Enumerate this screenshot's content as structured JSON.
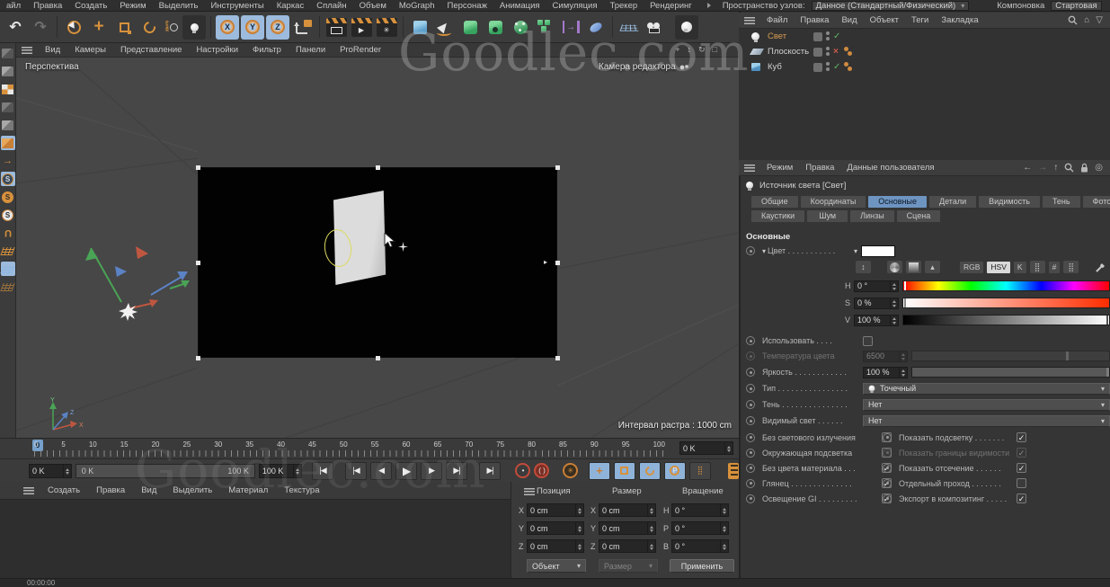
{
  "menubar": {
    "items": [
      "айл",
      "Правка",
      "Создать",
      "Режим",
      "Выделить",
      "Инструменты",
      "Каркас",
      "Сплайн",
      "Объем",
      "MoGraph",
      "Персонаж",
      "Анимация",
      "Симуляция",
      "Трекер",
      "Рендеринг"
    ],
    "node_space_label": "Пространство узлов:",
    "node_space_value": "Данное (Стандартный/Физический)",
    "layout_label": "Компоновка",
    "layout_value": "Стартовая"
  },
  "viewport": {
    "menu": [
      "Вид",
      "Камеры",
      "Представление",
      "Настройки",
      "Фильтр",
      "Панели",
      "ProRender"
    ],
    "view_label": "Перспектива",
    "camera_label": "Камера редактора",
    "raster_interval": "Интервал растра : 1000 cm",
    "axis": {
      "x": "X",
      "y": "Y",
      "z": "Z"
    }
  },
  "object_manager": {
    "menu": [
      "Файл",
      "Правка",
      "Вид",
      "Объект",
      "Теги",
      "Закладка"
    ],
    "objects": [
      {
        "name": "Свет",
        "state": "✓"
      },
      {
        "name": "Плоскость",
        "state": "×"
      },
      {
        "name": "Куб",
        "state": "✓"
      }
    ]
  },
  "attributes": {
    "menu": [
      "Режим",
      "Правка",
      "Данные пользователя"
    ],
    "title": "Источник света [Свет]",
    "tabs_row1": [
      "Общие",
      "Координаты",
      "Основные",
      "Детали",
      "Видимость",
      "Тень",
      "Фотометрия"
    ],
    "tabs_row2": [
      "Каустики",
      "Шум",
      "Линзы",
      "Сцена"
    ],
    "active_tab": "Основные",
    "section_title": "Основные",
    "color": {
      "label": "Цвет . . . . . . . . . . .",
      "rgb": "RGB",
      "hsv": "HSV",
      "k": "K",
      "hash": "#",
      "h_label": "H",
      "h_value": "0 °",
      "s_label": "S",
      "s_value": "0 %",
      "v_label": "V",
      "v_value": "100 %"
    },
    "rows": {
      "use_label": "Использовать . . . .",
      "temp_label": "Температура цвета",
      "temp_value": "6500",
      "brightness_label": "Яркость . . . . . . . . . . . .",
      "brightness_value": "100 %",
      "type_label": "Тип . . . . . . . . . . . . . . . .",
      "type_value": "Точечный",
      "shadow_label": "Тень . . . . . . . . . . . . . . .",
      "shadow_value": "Нет",
      "visible_label": "Видимый свет . . . . . .",
      "visible_value": "Нет"
    },
    "checkboxes_left": [
      {
        "label": "Без светового излучения",
        "mark": ""
      },
      {
        "label": "Окружающая подсветка",
        "mark": ""
      },
      {
        "label": "Без цвета материала . . .",
        "mark": "✓"
      },
      {
        "label": "Глянец . . . . . . . . . . . . . .",
        "mark": "✓"
      },
      {
        "label": "Освещение GI . . . . . . . . .",
        "mark": "✓"
      }
    ],
    "checkboxes_right": [
      {
        "label": "Показать подсветку . . . . . . .",
        "mark": "✓"
      },
      {
        "label": "Показать границы видимости",
        "mark": "✓",
        "dim": true
      },
      {
        "label": "Показать отсечение  . . . . . .",
        "mark": "✓"
      },
      {
        "label": "Отдельный проход  . . . . . . .",
        "mark": ""
      },
      {
        "label": "Экспорт в композитинг . . . . .",
        "mark": "✓"
      }
    ]
  },
  "timeline": {
    "ticks": [
      "0",
      "5",
      "10",
      "15",
      "20",
      "25",
      "30",
      "35",
      "40",
      "45",
      "50",
      "55",
      "60",
      "65",
      "70",
      "75",
      "80",
      "85",
      "90",
      "95",
      "100"
    ],
    "playhead": "0",
    "right_field": "0 K",
    "start_field": "0 K",
    "range_start": "0 K",
    "range_end": "100 K",
    "end_field": "100 K"
  },
  "transport": {
    "go_start": "|◀",
    "prev_key": "|◀",
    "prev_frame": "◀",
    "play": "▶",
    "next_frame": "▶",
    "next_key": "▶|",
    "go_end": "▶|"
  },
  "materials": {
    "menu": [
      "Создать",
      "Правка",
      "Вид",
      "Выделить",
      "Материал",
      "Текстура"
    ]
  },
  "coordinates": {
    "headers": [
      "Позиция",
      "Размер",
      "Вращение"
    ],
    "pos": [
      {
        "axis": "X",
        "value": "0 cm"
      },
      {
        "axis": "Y",
        "value": "0 cm"
      },
      {
        "axis": "Z",
        "value": "0 cm"
      }
    ],
    "size": [
      {
        "axis": "X",
        "value": "0 cm"
      },
      {
        "axis": "Y",
        "value": "0 cm"
      },
      {
        "axis": "Z",
        "value": "0 cm"
      }
    ],
    "rot": [
      {
        "axis": "H",
        "value": "0 °"
      },
      {
        "axis": "P",
        "value": "0 °"
      },
      {
        "axis": "B",
        "value": "0 °"
      }
    ],
    "object_dropdown": "Объект",
    "size_dropdown": "Размер",
    "apply_button": "Применить"
  },
  "statusbar": {
    "timecode": "00:00:00"
  },
  "watermark": "Goodlec.com",
  "icons": {
    "undo": "↶",
    "redo": "↷",
    "updown": "↕",
    "orbit": "↻",
    "pan": "+",
    "maximize": "□",
    "back": "←",
    "forward": "→",
    "up": "↑",
    "home": "⌂",
    "filter": "▽",
    "target": "◎",
    "chevron": "▾",
    "gear": "✳",
    "dots_grid": "⣿",
    "p_letter": "P",
    "psr": "P\nS\nR",
    "s_letter": "S",
    "u_magnet": "U",
    "x": "X",
    "y": "Y",
    "z": "Z",
    "key": "•",
    "autokey": "( )"
  },
  "colors": {
    "accent_orange": "#d7913c",
    "highlight_blue": "#8fb3d8",
    "tab_active": "#6e95c2",
    "selected_text": "#d79b51"
  }
}
